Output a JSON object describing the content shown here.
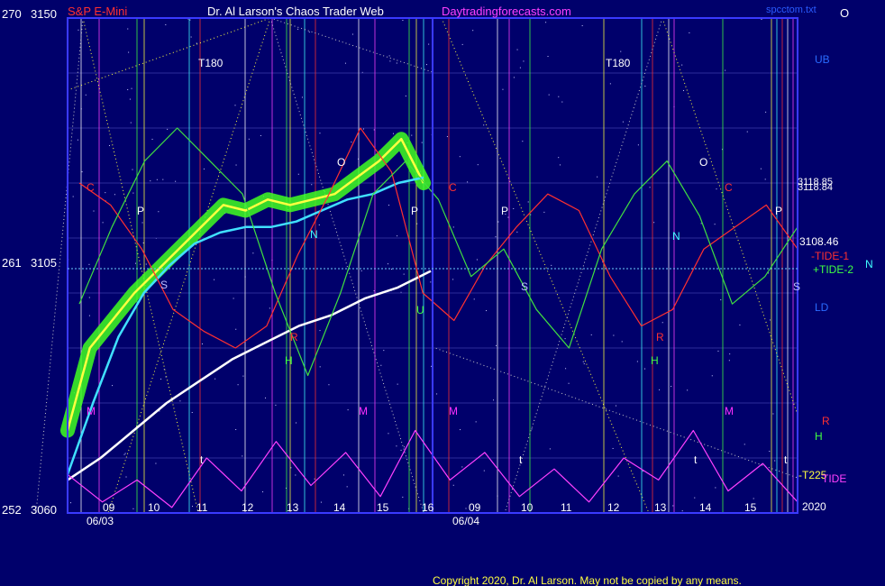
{
  "header": {
    "left_axis_top": "270",
    "price_top": "3150",
    "instrument": "S&P E-Mini",
    "site_title": "Dr. Al Larson's Chaos Trader Web",
    "site_url": "Daytradingforecasts.com",
    "right_top_file": "spcctom.txt",
    "right_top_marker": "O"
  },
  "left_axis": {
    "mid_label": "261",
    "mid_price": "3105",
    "bottom_label": "252",
    "bottom_price": "3060"
  },
  "right_labels": {
    "ub": "UB",
    "price1": "3118.85",
    "price2": "3118.84",
    "price3": "3108.46",
    "tide1": "-TIDE-1",
    "tide2": "+TIDE-2",
    "n": "N",
    "s": "S",
    "ld": "LD",
    "r": "R",
    "h": "H",
    "t225": "-T225",
    "tide": "TIDE",
    "year": "2020"
  },
  "copyright": "Copyright 2020, Dr. Al Larson. May not be copied by any means.",
  "chart_data": {
    "type": "line",
    "title": "S&P E-Mini",
    "y_axis": {
      "min": 3060,
      "max": 3150,
      "ticks": [
        3060,
        3105,
        3150
      ],
      "alt_ticks": [
        "252",
        "261",
        "270"
      ]
    },
    "x_axis": {
      "hour_labels": [
        "09",
        "10",
        "11",
        "12",
        "13",
        "14",
        "15",
        "16",
        "09",
        "10",
        "11",
        "12",
        "13",
        "14",
        "15"
      ],
      "date_labels": [
        "06/03",
        "06/04"
      ]
    },
    "panel_markers": [
      {
        "text": "T180",
        "color": "#ffffff"
      },
      {
        "text": "T180",
        "color": "#ffffff"
      },
      {
        "text": "C",
        "color": "#ff3030"
      },
      {
        "text": "C",
        "color": "#ff3030"
      },
      {
        "text": "C",
        "color": "#ff3030"
      },
      {
        "text": "P",
        "color": "#ffffff"
      },
      {
        "text": "P",
        "color": "#ffffff"
      },
      {
        "text": "P",
        "color": "#ffffff"
      },
      {
        "text": "P",
        "color": "#ffffff"
      },
      {
        "text": "O",
        "color": "#ffffff"
      },
      {
        "text": "O",
        "color": "#ffffff"
      },
      {
        "text": "S",
        "color": "#c0c0ff"
      },
      {
        "text": "S",
        "color": "#c0c0ff"
      },
      {
        "text": "N",
        "color": "#40ffff"
      },
      {
        "text": "N",
        "color": "#40ffff"
      },
      {
        "text": "R",
        "color": "#ff3030"
      },
      {
        "text": "R",
        "color": "#ff3030"
      },
      {
        "text": "H",
        "color": "#40ff40"
      },
      {
        "text": "H",
        "color": "#40ff40"
      },
      {
        "text": "M",
        "color": "#ff30ff"
      },
      {
        "text": "M",
        "color": "#ff30ff"
      },
      {
        "text": "M",
        "color": "#ff30ff"
      },
      {
        "text": "M",
        "color": "#ff30ff"
      },
      {
        "text": "t",
        "color": "#ffffff"
      },
      {
        "text": "t",
        "color": "#ffffff"
      },
      {
        "text": "t",
        "color": "#ffffff"
      },
      {
        "text": "t",
        "color": "#ffffff"
      },
      {
        "text": "U",
        "color": "#40ff40"
      }
    ],
    "series": [
      {
        "name": "",
        "color": "#ffff40",
        "values": [
          3075,
          3090,
          3095,
          3100,
          3104,
          3108,
          3112,
          3116,
          3115,
          3117,
          3116,
          3117,
          3118,
          3121,
          3124,
          3128,
          3120
        ]
      },
      {
        "name": "",
        "color": "#40e0ff",
        "values": [
          3067,
          3080,
          3092,
          3100,
          3105,
          3109,
          3111,
          3112,
          3112,
          3113,
          3115,
          3117,
          3118,
          3120,
          3121
        ]
      },
      {
        "name": "",
        "color": "#ffffff",
        "values": [
          3066,
          3070,
          3075,
          3080,
          3084,
          3088,
          3091,
          3094,
          3096,
          3099,
          3101,
          3104
        ]
      },
      {
        "name": "",
        "color": "#ff3030",
        "values": [
          3120,
          3116,
          3108,
          3097,
          3093,
          3090,
          3094,
          3107,
          3118,
          3130,
          3122,
          3100,
          3095,
          3105,
          3112,
          3118,
          3115,
          3103,
          3094,
          3097,
          3108,
          3112,
          3116,
          3108
        ]
      },
      {
        "name": "",
        "color": "#40e040",
        "values": [
          3098,
          3112,
          3124,
          3130,
          3124,
          3118,
          3100,
          3085,
          3100,
          3118,
          3124,
          3117,
          3103,
          3108,
          3097,
          3090,
          3108,
          3118,
          3124,
          3114,
          3098,
          3103,
          3112
        ]
      },
      {
        "name": "",
        "color": "#ff40ff",
        "values": [
          3067,
          3062,
          3066,
          3061,
          3070,
          3064,
          3073,
          3065,
          3071,
          3063,
          3075,
          3066,
          3071,
          3063,
          3068,
          3062,
          3070,
          3066,
          3075,
          3064,
          3069,
          3062
        ]
      }
    ]
  }
}
